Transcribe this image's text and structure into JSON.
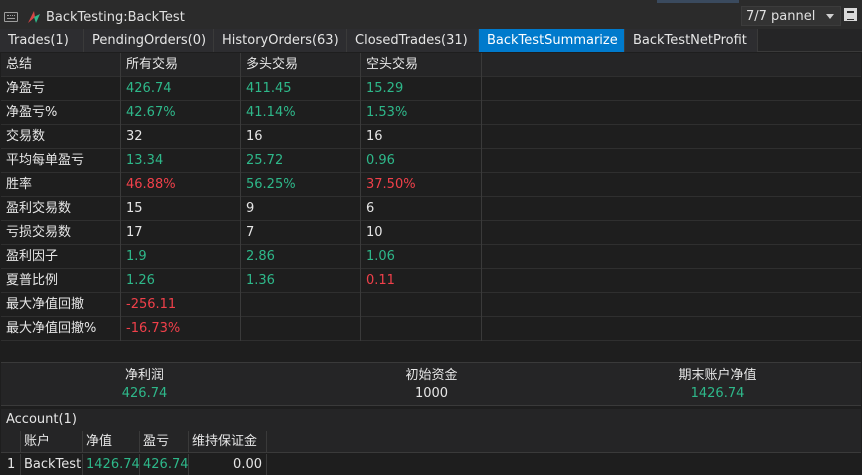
{
  "window": {
    "title": "BackTesting:BackTest",
    "panel_selector": "7/7 pannel"
  },
  "tabs": [
    {
      "label": "Trades(1)",
      "active": false
    },
    {
      "label": "PendingOrders(0)",
      "active": false
    },
    {
      "label": "HistoryOrders(63)",
      "active": false
    },
    {
      "label": "ClosedTrades(31)",
      "active": false
    },
    {
      "label": "BackTestSummarize",
      "active": true
    },
    {
      "label": "BackTestNetProfit",
      "active": false
    }
  ],
  "summary": {
    "columns": [
      "总结",
      "所有交易",
      "多头交易",
      "空头交易"
    ],
    "rows": [
      {
        "label": "净盈亏",
        "all": "426.74",
        "long": "411.45",
        "short": "15.29",
        "tone": [
          "pos",
          "pos",
          "pos"
        ]
      },
      {
        "label": "净盈亏%",
        "all": "42.67%",
        "long": "41.14%",
        "short": "1.53%",
        "tone": [
          "pos",
          "pos",
          "pos"
        ]
      },
      {
        "label": "交易数",
        "all": "32",
        "long": "16",
        "short": "16",
        "tone": [
          "neutral",
          "neutral",
          "neutral"
        ]
      },
      {
        "label": "平均每单盈亏",
        "all": "13.34",
        "long": "25.72",
        "short": "0.96",
        "tone": [
          "pos",
          "pos",
          "pos"
        ]
      },
      {
        "label": "胜率",
        "all": "46.88%",
        "long": "56.25%",
        "short": "37.50%",
        "tone": [
          "neg",
          "pos",
          "neg"
        ]
      },
      {
        "label": "盈利交易数",
        "all": "15",
        "long": "9",
        "short": "6",
        "tone": [
          "neutral",
          "neutral",
          "neutral"
        ]
      },
      {
        "label": "亏损交易数",
        "all": "17",
        "long": "7",
        "short": "10",
        "tone": [
          "neutral",
          "neutral",
          "neutral"
        ]
      },
      {
        "label": "盈利因子",
        "all": "1.9",
        "long": "2.86",
        "short": "1.06",
        "tone": [
          "pos",
          "pos",
          "pos"
        ]
      },
      {
        "label": "夏普比例",
        "all": "1.26",
        "long": "1.36",
        "short": "0.11",
        "tone": [
          "pos",
          "pos",
          "neg"
        ]
      },
      {
        "label": "最大净值回撤",
        "all": "-256.11",
        "long": "",
        "short": "",
        "tone": [
          "neg",
          "neutral",
          "neutral"
        ]
      },
      {
        "label": "最大净值回撤%",
        "all": "-16.73%",
        "long": "",
        "short": "",
        "tone": [
          "neg",
          "neutral",
          "neutral"
        ]
      }
    ]
  },
  "stats": [
    {
      "label": "净利润",
      "value": "426.74",
      "tone": "pos"
    },
    {
      "label": "初始资金",
      "value": "1000",
      "tone": "neutral"
    },
    {
      "label": "期末账户净值",
      "value": "1426.74",
      "tone": "pos"
    }
  ],
  "account": {
    "title": "Account(1)",
    "columns": [
      "账户",
      "净值",
      "盈亏",
      "维持保证金"
    ],
    "rows": [
      {
        "index": "1",
        "account": "BackTest",
        "equity": "1426.74",
        "pnl": "426.74",
        "margin": "0.00"
      }
    ]
  },
  "colors": {
    "positive": "#2eb88a",
    "negative": "#f0404a",
    "accent_tab": "#007acc"
  }
}
